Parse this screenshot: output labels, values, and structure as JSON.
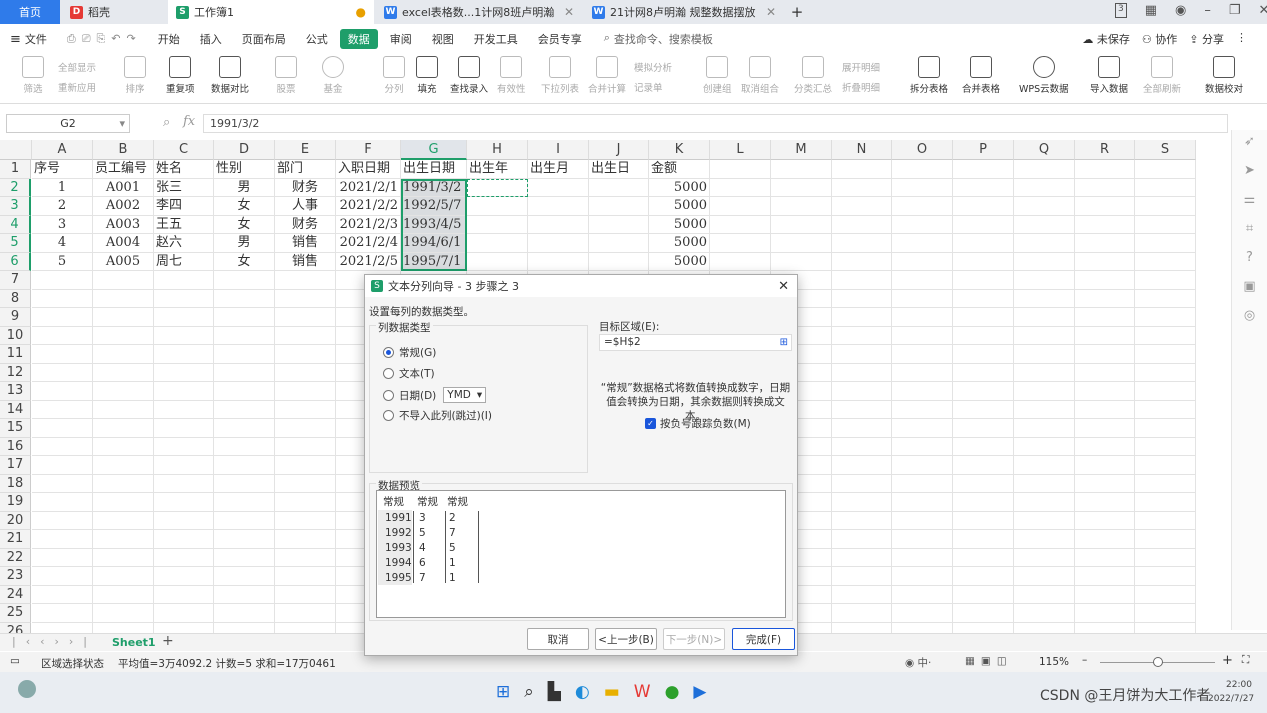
{
  "tabs": [
    {
      "label": "首页",
      "kind": "home"
    },
    {
      "label": "稻壳",
      "icon": "D",
      "color": "#e53935"
    },
    {
      "label": "工作簿1",
      "icon": "S",
      "color": "#1e9e6a",
      "active": true
    },
    {
      "label": "excel表格数...1计网8班卢明瀚",
      "icon": "W",
      "color": "#2f7bea"
    },
    {
      "label": "21计网8卢明瀚 规整数据摆放",
      "icon": "W",
      "color": "#2f7bea"
    }
  ],
  "tab_new": "+",
  "window_badge": "3",
  "menus": [
    "文件",
    "开始",
    "插入",
    "页面布局",
    "公式",
    "数据",
    "审阅",
    "视图",
    "开发工具",
    "会员专享"
  ],
  "active_menu": "数据",
  "search_placeholder": "查找命令、搜索模板",
  "right_menu": {
    "unsaved": "未保存",
    "collab": "协作",
    "share": "分享"
  },
  "ribbon": {
    "show_all": "全部显示",
    "reapply": "重新应用",
    "filter": "筛选",
    "sort": "排序",
    "dup": "重复项",
    "compare": "数据对比",
    "stock": "股票",
    "fund": "基金",
    "split": "分列",
    "fill": "填充",
    "lookup": "查找录入",
    "valid": "有效性",
    "dropdown": "下拉列表",
    "consolidate": "合并计算",
    "simulate": "模拟分析",
    "record": "记录单",
    "group": "创建组",
    "ungroup": "取消组合",
    "subtotal": "分类汇总",
    "expand": "展开明细",
    "collapse": "折叠明细",
    "split_table": "拆分表格",
    "merge_table": "合并表格",
    "wps_cloud": "WPS云数据",
    "import": "导入数据",
    "refresh_all": "全部刷新",
    "verify": "数据校对"
  },
  "name_box": "G2",
  "formula": "1991/3/2",
  "columns": [
    "A",
    "B",
    "C",
    "D",
    "E",
    "F",
    "G",
    "H",
    "I",
    "J",
    "K",
    "L",
    "M",
    "N",
    "O",
    "P",
    "Q",
    "R",
    "S"
  ],
  "rows": [
    [
      "序号",
      "员工编号",
      "姓名",
      "性别",
      "部门",
      "入职日期",
      "出生日期",
      "出生年",
      "出生月",
      "出生日",
      "金额"
    ],
    [
      "1",
      "A001",
      "张三",
      "男",
      "财务",
      "2021/2/1",
      "1991/3/2",
      "",
      "",
      "",
      "5000"
    ],
    [
      "2",
      "A002",
      "李四",
      "女",
      "人事",
      "2021/2/2",
      "1992/5/7",
      "",
      "",
      "",
      "5000"
    ],
    [
      "3",
      "A003",
      "王五",
      "女",
      "财务",
      "2021/2/3",
      "1993/4/5",
      "",
      "",
      "",
      "5000"
    ],
    [
      "4",
      "A004",
      "赵六",
      "男",
      "销售",
      "2021/2/4",
      "1994/6/1",
      "",
      "",
      "",
      "5000"
    ],
    [
      "5",
      "A005",
      "周七",
      "女",
      "销售",
      "2021/2/5",
      "1995/7/1",
      "",
      "",
      "",
      "5000"
    ]
  ],
  "row_numbers": [
    "1",
    "2",
    "3",
    "4",
    "5",
    "6",
    "7",
    "8",
    "9",
    "10",
    "11",
    "12",
    "13",
    "14",
    "15",
    "16",
    "17",
    "18",
    "19",
    "20",
    "21",
    "22",
    "23",
    "24",
    "25",
    "26"
  ],
  "sheet_tab": "Sheet1",
  "status": {
    "mode": "区域选择状态",
    "stats": "平均值=3万4092.2  计数=5  求和=17万0461",
    "zoom": "115%"
  },
  "dialog": {
    "title": "文本分列向导 - 3 步骤之 3",
    "prompt": "设置每列的数据类型。",
    "group_label": "列数据类型",
    "options": [
      "常规(G)",
      "文本(T)",
      "日期(D)",
      "不导入此列(跳过)(I)"
    ],
    "date_format": "YMD",
    "target_label": "目标区域(E):",
    "target_value": "=$H$2",
    "note": "“常规”数据格式将数值转换成数字，日期值会转换为日期，其余数据则转换成文本。",
    "checkbox": "按负号跟踪负数(M)",
    "preview_label": "数据预览",
    "preview_headers": [
      "常规",
      "常规",
      "常规"
    ],
    "preview_rows": [
      [
        "1991",
        "3",
        "2"
      ],
      [
        "1992",
        "5",
        "7"
      ],
      [
        "1993",
        "4",
        "5"
      ],
      [
        "1994",
        "6",
        "1"
      ],
      [
        "1995",
        "7",
        "1"
      ]
    ],
    "buttons": {
      "cancel": "取消",
      "back": "<上一步(B)",
      "next": "下一步(N)>",
      "finish": "完成(F)"
    }
  },
  "taskbar": {
    "watermark": "CSDN @王月饼为大工作者",
    "time": "22:00",
    "date": "2022/7/27"
  },
  "colors": {
    "accent": "#1e9e6a",
    "home_tab": "#2f7bea"
  }
}
